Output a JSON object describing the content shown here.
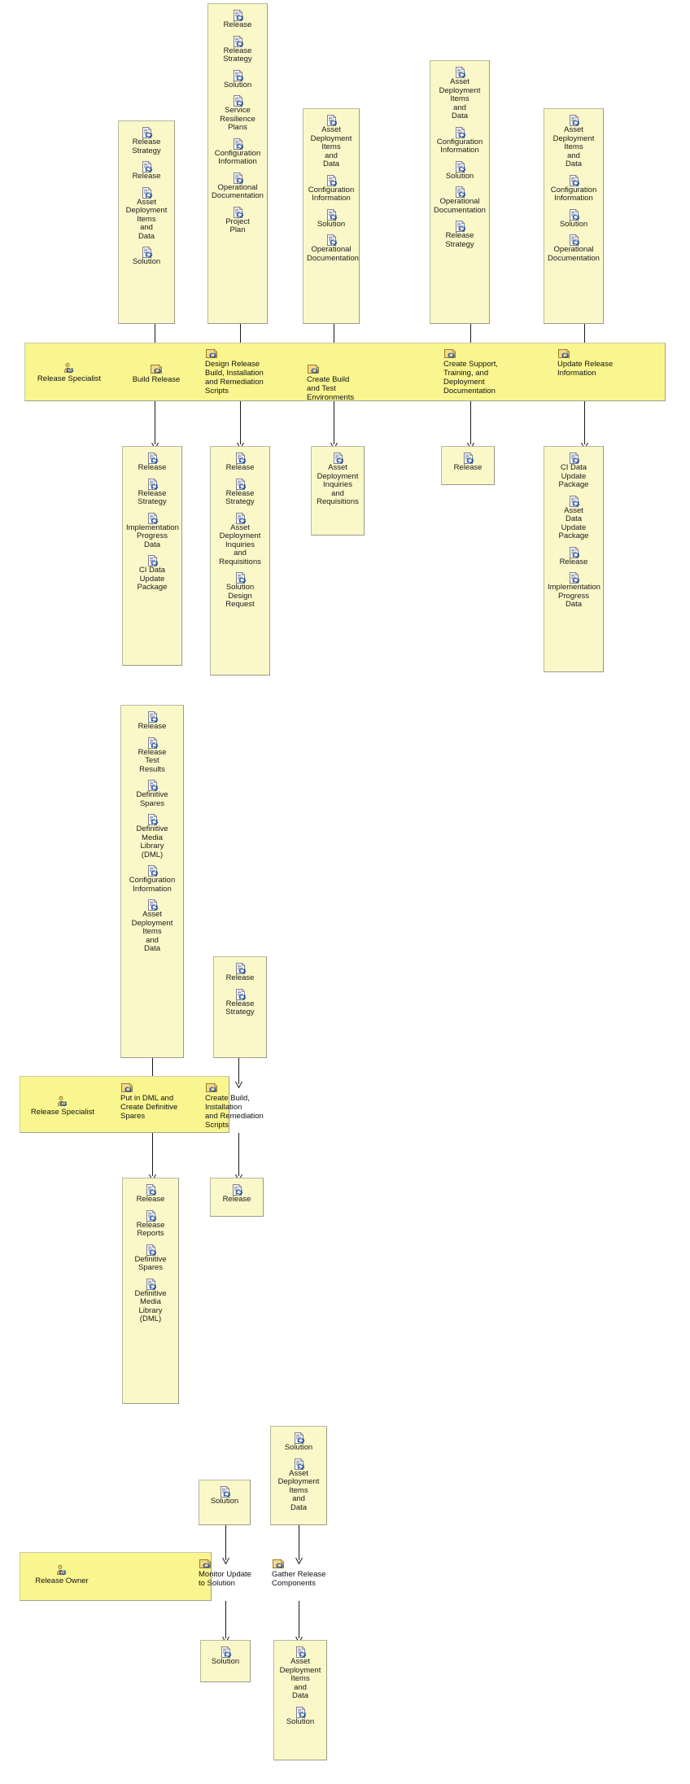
{
  "diagram": {
    "type": "activity-detail-diagram",
    "colors": {
      "artifact_box_fill": "#FAF8C8",
      "activity_lane_fill": "#FAF68F",
      "box_border": "#b8b8a0",
      "connector": "#1a1a1a",
      "icon_blue": "#1F4E9C",
      "icon_tan": "#E8C87A"
    },
    "icon_names": {
      "artifact": "work-product-icon",
      "activity": "activity-icon",
      "role": "role-icon"
    }
  },
  "sections": [
    {
      "id": "section-1",
      "inputs": [
        {
          "id": "in-1-1",
          "items": [
            "Release\nStrategy",
            "Release",
            "Asset\nDeployment\nItems\nand\nData",
            "Solution"
          ]
        },
        {
          "id": "in-1-2",
          "items": [
            "Release",
            "Release\nStrategy",
            "Solution",
            "Service\nResilience\nPlans",
            "Configuration\nInformation",
            "Operational\nDocumentation",
            "Project\nPlan"
          ]
        },
        {
          "id": "in-1-3",
          "items": [
            "Asset\nDeployment\nItems\nand\nData",
            "Configuration\nInformation",
            "Solution",
            "Operational\nDocumentation"
          ]
        },
        {
          "id": "in-1-4",
          "items": [
            "Asset\nDeployment\nItems\nand\nData",
            "Configuration\nInformation",
            "Solution",
            "Operational\nDocumentation",
            "Release\nStrategy"
          ]
        },
        {
          "id": "in-1-5",
          "items": [
            "Asset\nDeployment\nItems\nand\nData",
            "Configuration\nInformation",
            "Solution",
            "Operational\nDocumentation"
          ]
        }
      ],
      "lane": {
        "role": "Release Specialist",
        "activities": [
          "Build Release",
          "Design Release\nBuild, Installation\nand Remediation\nScripts",
          "Create Build\nand Test Environments",
          "Create Support,\nTraining, and\nDeployment Documentation",
          "Update Release\nInformation"
        ]
      },
      "outputs": [
        {
          "id": "out-1-1",
          "items": [
            "Release",
            "Release\nStrategy",
            "Implementation\nProgress\nData",
            "CI Data\nUpdate\nPackage"
          ]
        },
        {
          "id": "out-1-2",
          "items": [
            "Release",
            "Release\nStrategy",
            "Asset\nDeployment\nInquiries\nand\nRequisitions",
            "Solution\nDesign\nRequest"
          ]
        },
        {
          "id": "out-1-3",
          "items": [
            "Asset\nDeployment\nInquiries\nand\nRequisitions"
          ]
        },
        {
          "id": "out-1-4",
          "items": [
            "Release"
          ]
        },
        {
          "id": "out-1-5",
          "items": [
            "CI Data\nUpdate\nPackage",
            "Asset\nData\nUpdate\nPackage",
            "Release",
            "Implementation\nProgress\nData"
          ]
        }
      ]
    },
    {
      "id": "section-2",
      "inputs": [
        {
          "id": "in-2-1",
          "items": [
            "Release",
            "Release\nTest\nResults",
            "Definitive\nSpares",
            "Definitive\nMedia\nLibrary\n(DML)",
            "Configuration\nInformation",
            "Asset\nDeployment\nItems\nand\nData"
          ]
        },
        {
          "id": "in-2-2",
          "items": [
            "Release",
            "Release\nStrategy"
          ]
        }
      ],
      "lane": {
        "role": "Release Specialist",
        "activities": [
          "Put in DML and\nCreate Definitive\nSpares",
          "Create Build,\nInstallation\nand Remediation\nScripts"
        ]
      },
      "outputs": [
        {
          "id": "out-2-1",
          "items": [
            "Release",
            "Release\nReports",
            "Definitive\nSpares",
            "Definitive\nMedia\nLibrary\n(DML)"
          ]
        },
        {
          "id": "out-2-2",
          "items": [
            "Release"
          ]
        }
      ]
    },
    {
      "id": "section-3",
      "inputs": [
        {
          "id": "in-3-1",
          "items": [
            "Solution"
          ]
        },
        {
          "id": "in-3-2",
          "items": [
            "Solution",
            "Asset\nDeployment\nItems\nand\nData"
          ]
        }
      ],
      "lane": {
        "role": "Release Owner",
        "activities": [
          "Monitor Update\nto Solution",
          "Gather Release\nComponents"
        ]
      },
      "outputs": [
        {
          "id": "out-3-1",
          "items": [
            "Solution"
          ]
        },
        {
          "id": "out-3-2",
          "items": [
            "Asset\nDeployment\nItems\nand\nData",
            "Solution"
          ]
        }
      ]
    }
  ]
}
